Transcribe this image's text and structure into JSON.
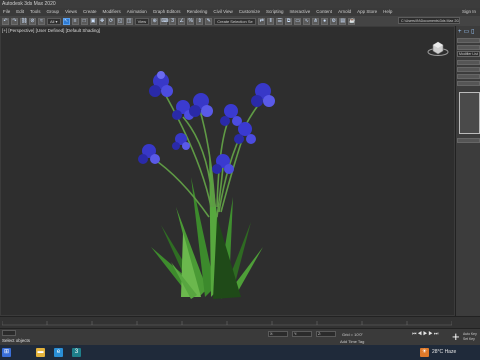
{
  "window": {
    "title": "Autodesk 3ds Max 2020"
  },
  "menu": {
    "items": [
      "File",
      "Edit",
      "Tools",
      "Group",
      "Views",
      "Create",
      "Modifiers",
      "Animation",
      "Graph Editors",
      "Rendering",
      "Civil View",
      "Customize",
      "Scripting",
      "Interactive",
      "Content",
      "Arnold",
      "App Store",
      "Help"
    ],
    "signin": "Sign In"
  },
  "toolbar": {
    "view_dropdown": "View",
    "selection_set": "Create Selection Se",
    "project_path": "C:\\Users\\IN\\Documents\\3ds Max 2020"
  },
  "viewport": {
    "label": "[+] [Perspective] [User Defined] [Default Shading]"
  },
  "command_panel": {
    "modifier_list": "Modifier List"
  },
  "status": {
    "selection": "Select objects",
    "coords": [
      "X:",
      "Y:",
      "Z:"
    ],
    "grid": "Grid = 10'0\"",
    "add_time_tag": "Add Time Tag",
    "auto_key": "Auto Key",
    "set_key": "Set Key",
    "selected": "Selected"
  },
  "taskbar": {
    "weather_temp": "28°C",
    "weather_desc": "Haze"
  },
  "colors": {
    "accent": "#2e7bd3",
    "flower": "#3a3ad0",
    "leaf": "#3f8f2f"
  }
}
